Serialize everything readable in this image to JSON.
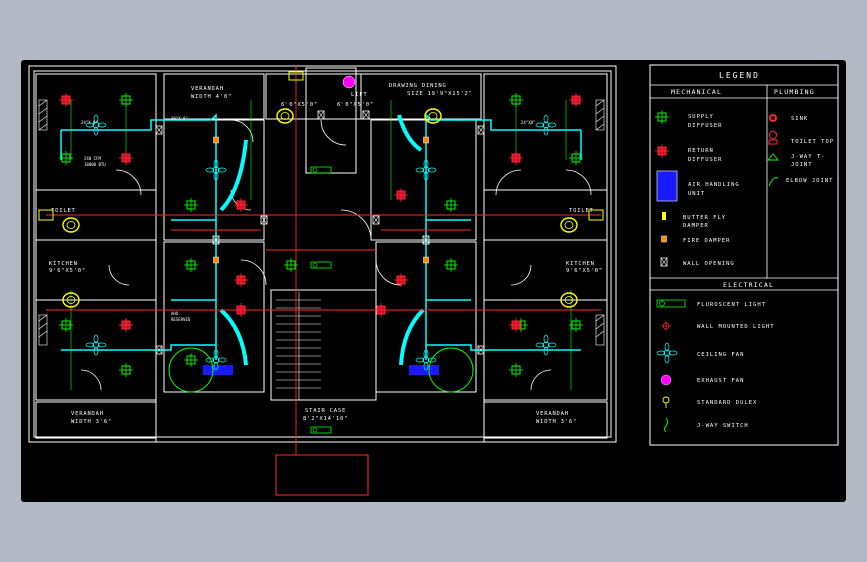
{
  "colors": {
    "background": "#b3bac6",
    "sheet": "#000000",
    "wall": "#ffffff",
    "duct": "#00ffff",
    "red": "#ff2a2a",
    "green": "#00ff00",
    "yellow": "#ffff00",
    "magenta": "#ff00ff",
    "blue": "#1a1aff",
    "orange": "#ff8800"
  },
  "plan": {
    "rooms": {
      "verandah_top": "VERANDAH",
      "verandah_top_size": "WIDTH 4'0\"",
      "drawing_dining": "DRAWING DINING",
      "drawing_dining_size": "SIZE 19'9\"X15'2\"",
      "toilet_left": "TOILET",
      "toilet_right": "TOILET",
      "kitchen_left": "KITCHEN",
      "kitchen_left_size": "9'6\"X5'0\"",
      "kitchen_right": "KITCHEN",
      "kitchen_right_size": "9'6\"X5'0\"",
      "lift": "LIFT",
      "lift_size": "6'0\"X5'0\"",
      "lift_size_right": "6'0\"X5'0\"",
      "verandah_bottom_left": "VERANDAH",
      "verandah_bottom_left_size": "WIDTH 3'6\"",
      "verandah_bottom_right": "VERANDAH",
      "verandah_bottom_right_size": "WIDTH 3'6\"",
      "staircase": "STAIR CASE",
      "staircase_size": "8'2\"X14'10\""
    },
    "duct_label": "24\"X 8\"",
    "duct_label_b": "24\"X8\"",
    "duct_label_c": "30\"X 8\"",
    "ahu_note": "AHU",
    "ahu_note_b": "RESERVED",
    "spec_note": "240 CFM",
    "spec_note_b": "18000 BTU"
  },
  "legend": {
    "title": "LEGEND",
    "mechanical_header": "MECHANICAL",
    "plumbing_header": "PLUMBING",
    "electrical_header": "ELECTRICAL",
    "mechanical": [
      {
        "icon": "supply-diffuser-icon",
        "label1": "SUPPLY",
        "label2": "DIFFUSER"
      },
      {
        "icon": "return-diffuser-icon",
        "label1": "RETURN",
        "label2": "DIFFUSER"
      },
      {
        "icon": "air-handling-unit-icon",
        "label1": "AIR HANDLING",
        "label2": "UNIT"
      },
      {
        "icon": "butterfly-damper-icon",
        "label1": "BUTTER FLY",
        "label2": "DAMPER"
      },
      {
        "icon": "fire-damper-icon",
        "label1": "FIRE DAMPER",
        "label2": ""
      },
      {
        "icon": "wall-opening-icon",
        "label1": "WALL OPENING",
        "label2": ""
      }
    ],
    "plumbing": [
      {
        "icon": "sink-icon",
        "label1": "SINK",
        "label2": ""
      },
      {
        "icon": "toilet-top-icon",
        "label1": "TOILET TOP",
        "label2": ""
      },
      {
        "icon": "j-way-t-joint-icon",
        "label1": "J-WAY T-",
        "label2": "JOINT"
      },
      {
        "icon": "elbow-joint-icon",
        "label1": "ELBOW JOINT",
        "label2": ""
      }
    ],
    "electrical": [
      {
        "icon": "fluorescent-light-icon",
        "label": "FLUROSCENT LIGHT"
      },
      {
        "icon": "wall-mounted-light-icon",
        "label": "WALL MOUNTED LIGHT"
      },
      {
        "icon": "ceiling-fan-icon",
        "label": "CEILING FAN"
      },
      {
        "icon": "exhaust-fan-icon",
        "label": "EXHAUST FAN"
      },
      {
        "icon": "standard-duplex-icon",
        "label": "STANDARD DULEX"
      },
      {
        "icon": "j-way-switch-icon",
        "label": "J-WAY SWITCH"
      }
    ]
  }
}
